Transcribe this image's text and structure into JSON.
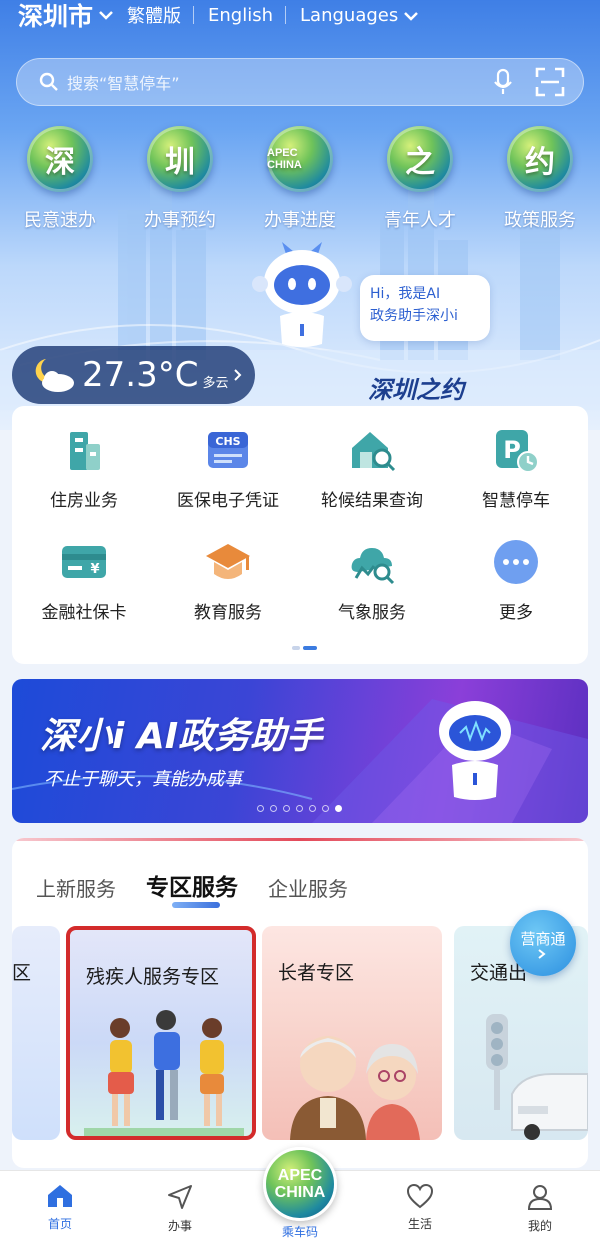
{
  "topbar": {
    "city": "深圳市",
    "traditional": "繁體版",
    "english": "English",
    "languages": "Languages"
  },
  "search": {
    "placeholder": "搜索“智慧停车”"
  },
  "quick_links": [
    {
      "glyph": "深",
      "label": "民意速办"
    },
    {
      "glyph": "圳",
      "label": "办事预约"
    },
    {
      "glyph": "APEC CHINA",
      "label": "办事进度"
    },
    {
      "glyph": "之",
      "label": "青年人才"
    },
    {
      "glyph": "约",
      "label": "政策服务"
    }
  ],
  "assistant_bubble": {
    "line1": "Hi，我是AI",
    "line2": "政务助手深小i"
  },
  "slogan": "深圳之约",
  "weather": {
    "temp": "27.3°C",
    "condition": "多云"
  },
  "services": [
    {
      "label": "住房业务",
      "icon": "building-icon"
    },
    {
      "label": "医保电子凭证",
      "icon": "chs-card-icon",
      "icon_text": "CHS"
    },
    {
      "label": "轮候结果查询",
      "icon": "house-search-icon"
    },
    {
      "label": "智慧停车",
      "icon": "parking-icon",
      "icon_text": "P"
    },
    {
      "label": "金融社保卡",
      "icon": "bank-card-icon",
      "icon_text": "¥"
    },
    {
      "label": "教育服务",
      "icon": "graduation-cap-icon"
    },
    {
      "label": "气象服务",
      "icon": "weather-search-icon"
    },
    {
      "label": "更多",
      "icon": "more-dots-icon"
    }
  ],
  "banner": {
    "title": "深小i AI政务助手",
    "subtitle": "不止于聊天，真能办成事"
  },
  "zone": {
    "tabs": [
      "上新服务",
      "专区服务",
      "企业服务"
    ],
    "active_tab": 1,
    "cards": [
      {
        "title": "区"
      },
      {
        "title": "残疾人服务专区"
      },
      {
        "title": "长者专区"
      },
      {
        "title": "交通出"
      }
    ],
    "float_badge": "营商通"
  },
  "nav": [
    {
      "label": "首页",
      "icon": "home-icon",
      "active": true
    },
    {
      "label": "办事",
      "icon": "navigate-icon"
    },
    {
      "label": "乘车码",
      "icon": "apec-globe-icon",
      "center_text1": "APEC",
      "center_text2": "CHINA"
    },
    {
      "label": "生活",
      "icon": "heart-icon"
    },
    {
      "label": "我的",
      "icon": "person-icon"
    }
  ],
  "colors": {
    "primary": "#3f7fe6",
    "accent_red": "#d32b2b",
    "nav_active": "#2f6fe0"
  }
}
